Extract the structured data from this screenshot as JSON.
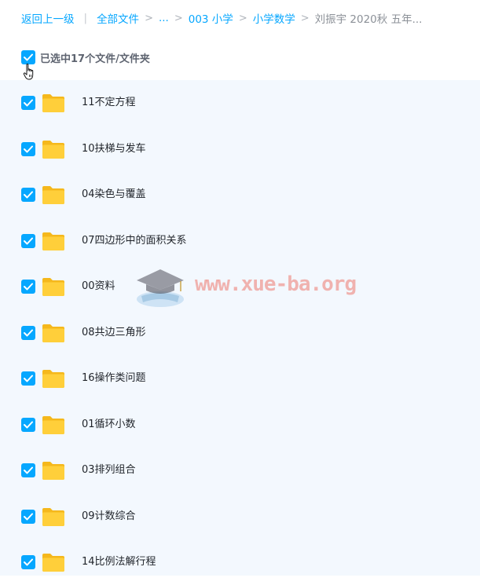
{
  "breadcrumb": {
    "back": "返回上一级",
    "all_files": "全部文件",
    "ellipsis": "...",
    "level1": "003 小学",
    "level2": "小学数学",
    "current": "刘振宇 2020秋 五年..."
  },
  "selection": {
    "text": "已选中17个文件/文件夹",
    "checked": true
  },
  "files": [
    {
      "name": "11不定方程",
      "checked": true
    },
    {
      "name": "10扶梯与发车",
      "checked": true
    },
    {
      "name": "04染色与覆盖",
      "checked": true
    },
    {
      "name": "07四边形中的面积关系",
      "checked": true
    },
    {
      "name": "00资料",
      "checked": true
    },
    {
      "name": "08共边三角形",
      "checked": true
    },
    {
      "name": "16操作类问题",
      "checked": true
    },
    {
      "name": "01循环小数",
      "checked": true
    },
    {
      "name": "03排列组合",
      "checked": true
    },
    {
      "name": "09计数综合",
      "checked": true
    },
    {
      "name": "14比例法解行程",
      "checked": true
    }
  ],
  "watermark": {
    "text": "www.xue-ba.org"
  },
  "colors": {
    "accent": "#06a7ff",
    "folder": "#ffc930",
    "list_bg": "#f3f8fe"
  },
  "icons": {
    "folder": "folder-icon",
    "checkbox": "checkbox-checked-icon",
    "cursor": "hand-pointer-icon"
  }
}
